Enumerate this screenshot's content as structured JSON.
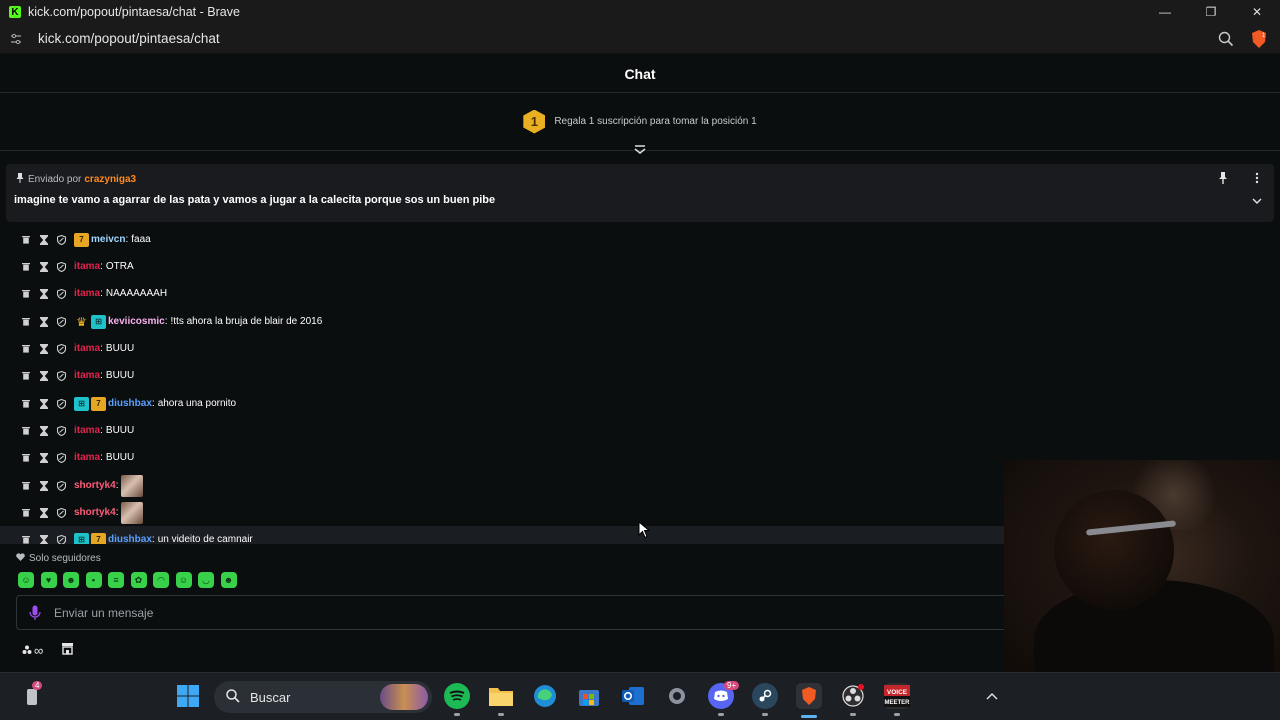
{
  "window": {
    "title": "kick.com/popout/pintaesa/chat - Brave",
    "url": "kick.com/popout/pintaesa/chat",
    "minimize": "—",
    "maximize": "❐",
    "close": "✕",
    "brave_badge_count": "1"
  },
  "chat": {
    "header": "Chat",
    "sub_banner": {
      "rank": "1",
      "text": "Regala 1 suscripción para tomar la posición 1"
    },
    "pinned": {
      "sent_by_label": "Enviado por",
      "sent_by_user": "crazyniga3",
      "message": "imagine te vamo a agarrar de las pata y vamos a jugar a la calecita porque sos un buen pibe"
    },
    "messages": [
      {
        "badges": [
          "sub7"
        ],
        "user": "meivcn",
        "user_color": "#9fd7ff",
        "text": "faaa"
      },
      {
        "badges": [],
        "user": "itama",
        "user_color": "#e0234e",
        "text": "OTRA"
      },
      {
        "badges": [],
        "user": "itama",
        "user_color": "#e0234e",
        "text": "NAAAAAAAH"
      },
      {
        "badges": [
          "crown",
          "gift"
        ],
        "user": "keviicosmic",
        "user_color": "#f9b2f0",
        "text": "!tts ahora la bruja de blair de 2016"
      },
      {
        "badges": [],
        "user": "itama",
        "user_color": "#e0234e",
        "text": "BUUU"
      },
      {
        "badges": [],
        "user": "itama",
        "user_color": "#e0234e",
        "text": "BUUU"
      },
      {
        "badges": [
          "gift",
          "sub7"
        ],
        "user": "diushbax",
        "user_color": "#5aa0ff",
        "text": "ahora una pornito"
      },
      {
        "badges": [],
        "user": "itama",
        "user_color": "#e0234e",
        "text": "BUUU"
      },
      {
        "badges": [],
        "user": "itama",
        "user_color": "#e0234e",
        "text": "BUUU"
      },
      {
        "badges": [],
        "user": "shortyk4",
        "user_color": "#ff5b7a",
        "text": "",
        "emote": true
      },
      {
        "badges": [],
        "user": "shortyk4",
        "user_color": "#ff5b7a",
        "text": "",
        "emote": true
      },
      {
        "badges": [
          "gift",
          "sub7"
        ],
        "user": "diushbax",
        "user_color": "#5aa0ff",
        "text": "un videito de camnair",
        "hover": true
      }
    ],
    "followers_only": "Solo seguidores",
    "input_placeholder": "Enviar un mensaje",
    "bottom_infinity": "∞"
  },
  "taskbar": {
    "search_label": "Buscar",
    "notif_count": "4",
    "discord_badge": "9+",
    "voicemeeter_label": "VOICE\nMEETER"
  },
  "colors": {
    "accent_green": "#53fc18",
    "background": "#0b0e0f"
  }
}
